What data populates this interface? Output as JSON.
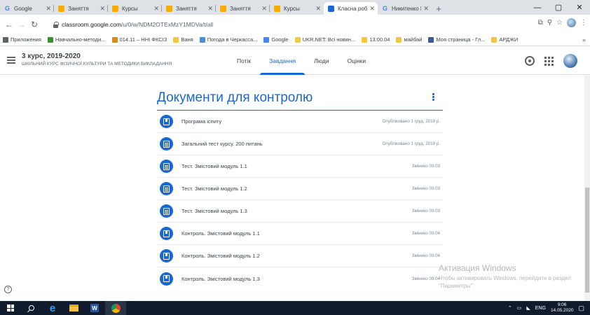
{
  "browser": {
    "tabs": [
      {
        "label": "Google",
        "favicon": "google-icon",
        "color": "#4285f4",
        "glyph": "G"
      },
      {
        "label": "Заняття",
        "favicon": "classroom-icon",
        "color": "#f9ab00",
        "glyph": ""
      },
      {
        "label": "Курсы",
        "favicon": "classroom-icon",
        "color": "#f9ab00",
        "glyph": ""
      },
      {
        "label": "Заняття",
        "favicon": "classroom-icon",
        "color": "#f9ab00",
        "glyph": ""
      },
      {
        "label": "Заняття",
        "favicon": "classroom-icon",
        "color": "#f9ab00",
        "glyph": ""
      },
      {
        "label": "Курсы",
        "favicon": "classroom-icon",
        "color": "#f9ab00",
        "glyph": ""
      },
      {
        "label": "Класна робот",
        "favicon": "classroom-task-icon",
        "color": "#1967d2",
        "glyph": ""
      },
      {
        "label": "Никитенко В.",
        "favicon": "google-icon",
        "color": "#4285f4",
        "glyph": "G"
      }
    ],
    "url_host": "classroom.google.com",
    "url_path": "/u/0/w/NDM2OTExMzY1MDVa/t/all",
    "bookmarks": [
      {
        "label": "Приложения",
        "icon": "apps-icon",
        "color": "#5f6368"
      },
      {
        "label": "Навчально-методи...",
        "icon": "nv-icon",
        "color": "#3c8d2f"
      },
      {
        "label": "014.11 – ННІ ФКСІЗ",
        "icon": "site-icon",
        "color": "#d18b1f"
      },
      {
        "label": "Ваня",
        "icon": "folder-icon",
        "color": "#f6c445"
      },
      {
        "label": "Погода в Черкасса...",
        "icon": "weather-icon",
        "color": "#4a90d9"
      },
      {
        "label": "Google",
        "icon": "google-icon",
        "color": "#4285f4"
      },
      {
        "label": "UKR.NET: Всі новин...",
        "icon": "ukrnet-icon",
        "color": "#f2c94c"
      },
      {
        "label": "13.00.04",
        "icon": "folder-icon",
        "color": "#f6c445"
      },
      {
        "label": "майбай",
        "icon": "folder-icon",
        "color": "#f6c445"
      },
      {
        "label": "Моя страница - Гл...",
        "icon": "facebook-icon",
        "color": "#3b5998"
      },
      {
        "label": "АРДЖИ",
        "icon": "folder-icon",
        "color": "#f6c445"
      }
    ],
    "bookmarks_more": "»"
  },
  "classroom": {
    "course_title": "3 курс, 2019-2020",
    "course_subtitle": "ШКІЛЬНИЙ КУРС ФІЗИЧНОЇ КУЛЬТУРИ ТА МЕТОДИКИ ВИКЛАДАННЯ",
    "nav": [
      {
        "label": "Потік",
        "active": false
      },
      {
        "label": "Завдання",
        "active": true
      },
      {
        "label": "Люди",
        "active": false
      },
      {
        "label": "Оцінки",
        "active": false
      }
    ],
    "accent": "#1967d2"
  },
  "section": {
    "title": "Документи для контролю",
    "items": [
      {
        "title": "Програма іспиту",
        "status": "Опубліковано 1 груд. 2019 р.",
        "icon": "material-icon"
      },
      {
        "title": "Загальний тест курсу. 200 питань",
        "status": "Опубліковано 1 груд. 2019 р.",
        "icon": "assignment-icon"
      },
      {
        "title": "Тест. Змістовий модуль 1.1",
        "status": "Змінено 09:03",
        "icon": "assignment-icon"
      },
      {
        "title": "Тест. Змістовий модуль 1.2",
        "status": "Змінено 09:03",
        "icon": "assignment-icon"
      },
      {
        "title": "Тест. Змістовий модуль 1.3",
        "status": "Змінено 09:03",
        "icon": "assignment-icon"
      },
      {
        "title": "Контроль. Змістовий модуль 1.1",
        "status": "Змінено 09:04",
        "icon": "material-icon"
      },
      {
        "title": "Контроль. Змістовий модуль 1.2",
        "status": "Змінено 09:04",
        "icon": "material-icon"
      },
      {
        "title": "Контроль. Змістовий модуль 1.3",
        "status": "Змінено 09:04",
        "icon": "material-icon"
      }
    ]
  },
  "watermark": {
    "line1": "Активация Windows",
    "line2": "Чтобы активировать Windows, перейдите в раздел \"Параметры\"."
  },
  "taskbar": {
    "lang": "ENG",
    "time": "9:06",
    "date": "14.05.2020"
  }
}
